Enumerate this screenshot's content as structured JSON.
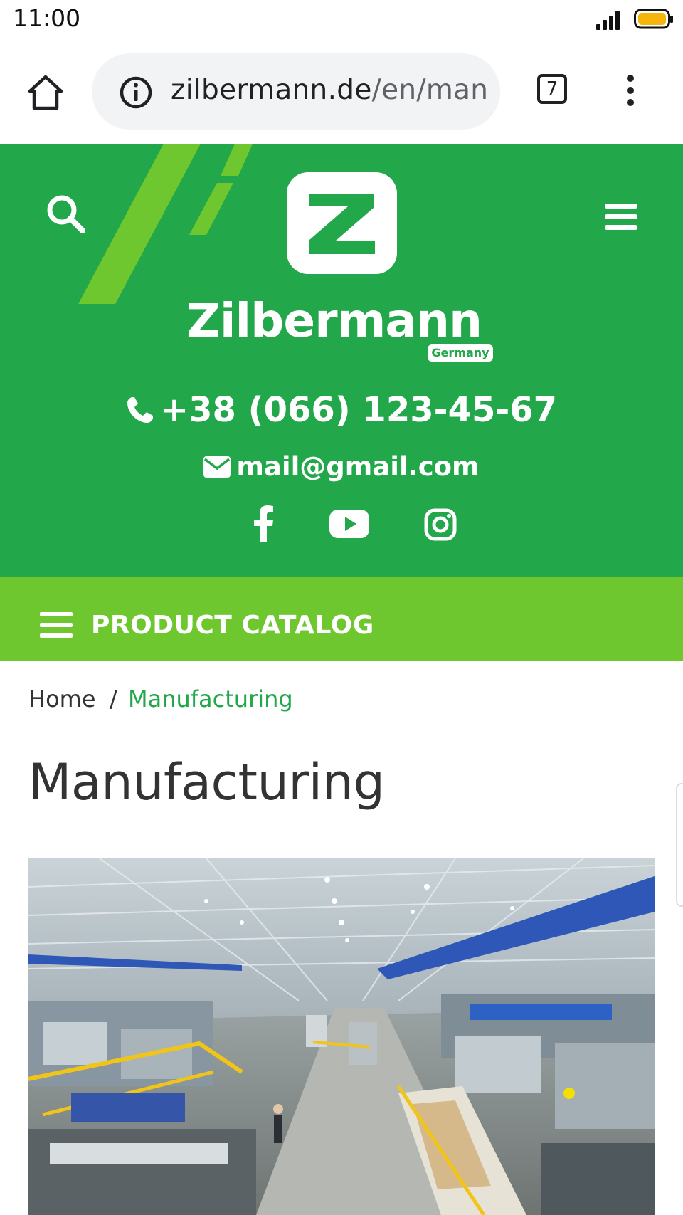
{
  "status_bar": {
    "time": "11:00",
    "signal_icon": "signal-icon",
    "battery_icon": "battery-icon",
    "battery_color": "#f5b50a"
  },
  "browser": {
    "home_icon": "home-icon",
    "info_icon": "info-icon",
    "url_host": "zilbermann.de",
    "url_path": "/en/man",
    "tab_count": "7",
    "menu_icon": "more-vert-icon"
  },
  "header": {
    "brand_name": "Zilbermann",
    "brand_sub": "Germany",
    "logo_letter": "Z",
    "phone": "+38 (066) 123-45-67",
    "email": "mail@gmail.com",
    "background_color": "#22a74a",
    "accent_color": "#6ec72f",
    "social": [
      "facebook-icon",
      "youtube-icon",
      "instagram-icon"
    ]
  },
  "catalog": {
    "label": "PRODUCT CATALOG"
  },
  "breadcrumb": {
    "home": "Home",
    "separator": "/",
    "current": "Manufacturing"
  },
  "page": {
    "title": "Manufacturing"
  }
}
